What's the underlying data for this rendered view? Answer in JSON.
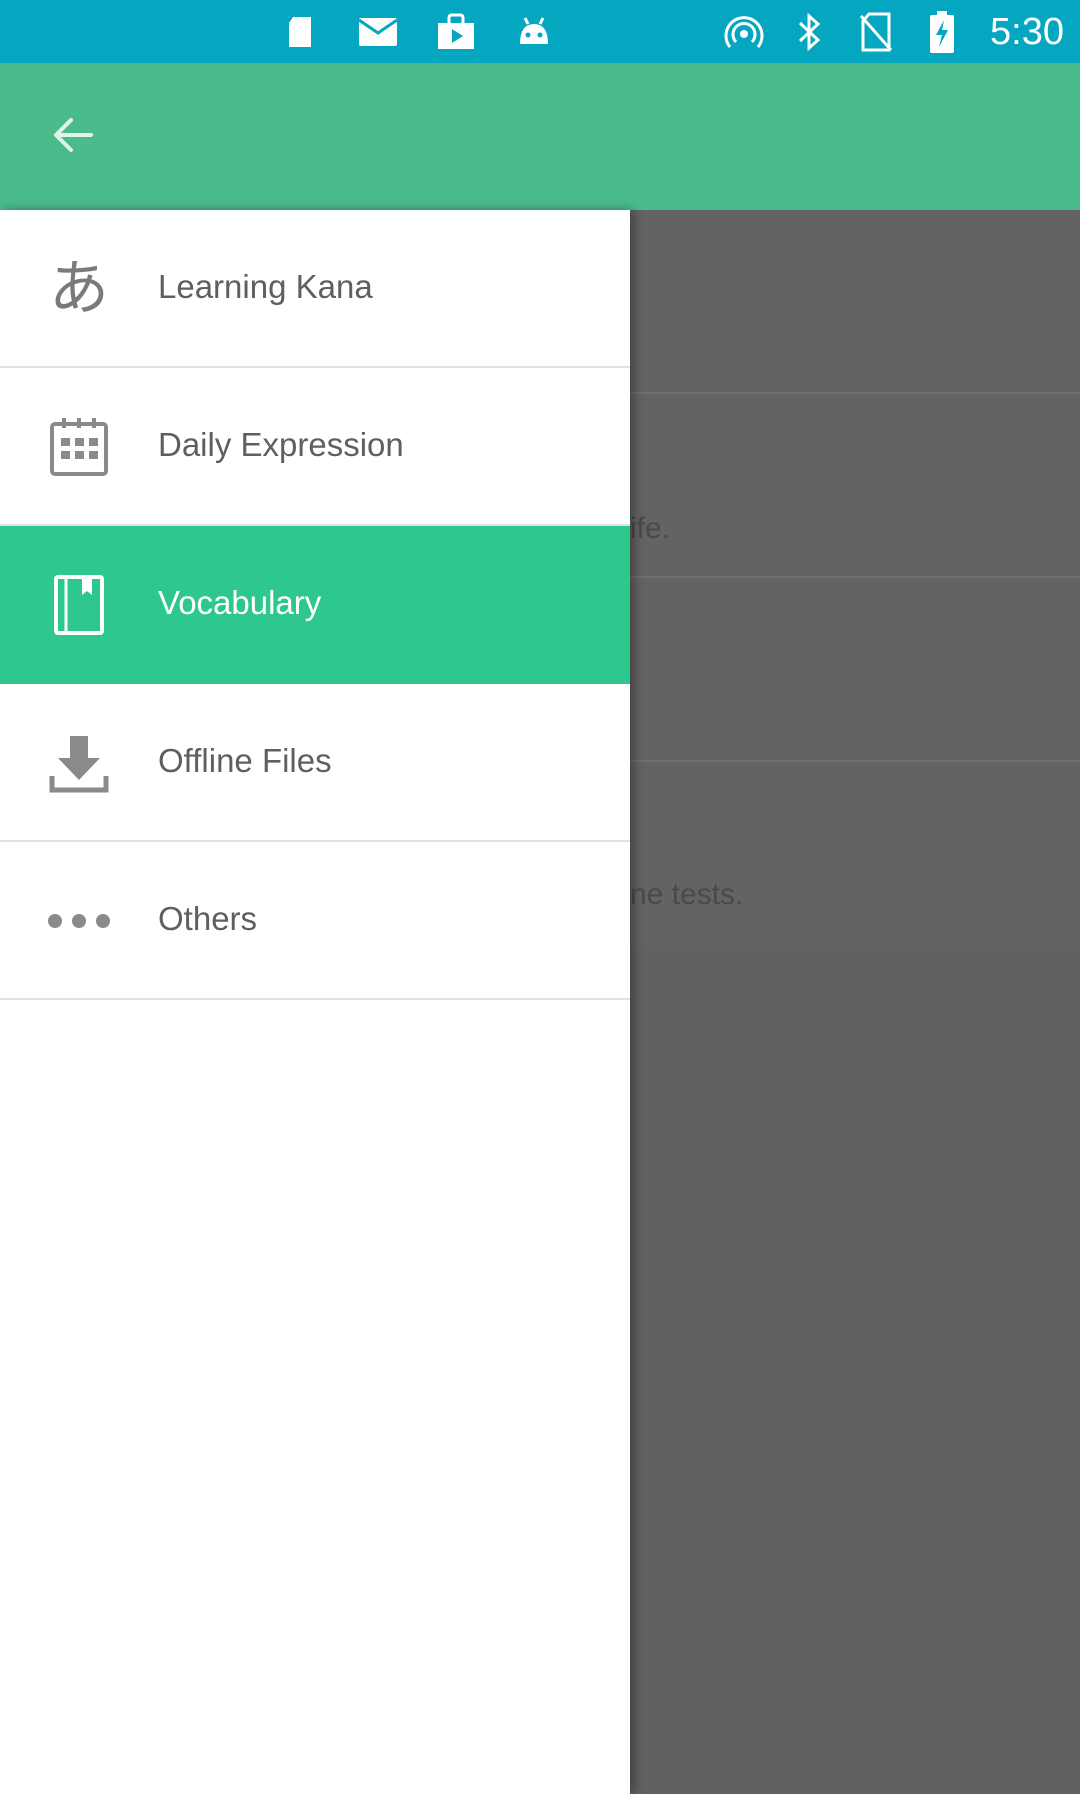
{
  "status_bar": {
    "time": "5:30",
    "left_icons": [
      "sd-card-icon",
      "mail-icon",
      "play-store-icon",
      "android-icon"
    ],
    "right_icons": [
      "hotspot-icon",
      "bluetooth-icon",
      "no-sim-icon",
      "battery-charging-icon"
    ]
  },
  "toolbar": {
    "back_icon": "arrow-back-icon"
  },
  "drawer": {
    "items": [
      {
        "label": "Learning Kana",
        "icon": "kana-icon",
        "glyph": "あ",
        "selected": false
      },
      {
        "label": "Daily Expression",
        "icon": "calendar-icon",
        "selected": false
      },
      {
        "label": "Vocabulary",
        "icon": "book-icon",
        "selected": true
      },
      {
        "label": "Offline Files",
        "icon": "download-icon",
        "selected": false
      },
      {
        "label": "Others",
        "icon": "more-horizontal-icon",
        "selected": false
      }
    ]
  },
  "background": {
    "fragments": [
      "ife.",
      "ne tests."
    ]
  },
  "colors": {
    "status_bar": "#05a6bf",
    "toolbar": "#4bbb8b",
    "selected_item": "#2ec88f",
    "scrim": "#616161"
  }
}
